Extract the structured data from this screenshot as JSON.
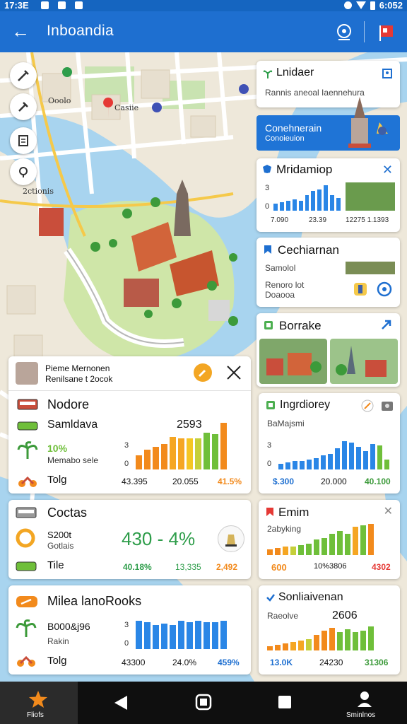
{
  "status_bar": {
    "time": "17:3E",
    "right_time": "6:052"
  },
  "app_bar": {
    "title": "Inboandia"
  },
  "map": {
    "labels": [
      "Ooolo",
      "Casiie",
      "2ctionis"
    ]
  },
  "cards": {
    "top_right": {
      "title": "Lnidaer",
      "subtitle": "Rannis aneoal Iaennehura"
    },
    "banner": {
      "line1": "Conehnerain",
      "line2": "Conoieuion"
    },
    "middle_right": {
      "title": "Mridamiop",
      "tick_3": "3",
      "tick_0": "0",
      "v1": "7.090",
      "v2": "23.39",
      "v3": "12275 1.1393"
    },
    "cechiarnan": {
      "title": "Cechiarnan",
      "line1": "Samolol",
      "line2": "Renoro lot",
      "line3": "Doaooa"
    },
    "bornake": {
      "title": "Borrake"
    },
    "stats_left": {
      "header_line1": "Pieme Mernonen",
      "header_line2": "Renilsane t 2ocok",
      "title": "Nodore",
      "subtitle": "Samldava",
      "headline": "2593",
      "pct": "10%",
      "sub_label": "Memabo sele",
      "tick_3": "3",
      "tick_0": "0",
      "foot_label": "Tolg",
      "foot_v1": "43.395",
      "foot_v2": "20.055",
      "foot_v3": "41.5%"
    },
    "stats_right": {
      "title": "Ingrdiorey",
      "subtitle": "BaMajsmi",
      "tick_3": "3",
      "tick_0": "0",
      "foot_v1": "$.300",
      "foot_v2": "20.000",
      "foot_v3": "40.100"
    },
    "coctas": {
      "title": "Coctas",
      "line1": "S200t",
      "line2": "Gotlais",
      "big": "430 - 4%",
      "foot_label": "Tile",
      "foot_v1": "40.18%",
      "foot_v2": "13,335",
      "foot_v3": "2,492"
    },
    "emim": {
      "title": "Emim",
      "subtitle": "2abyking",
      "foot_v1": "600",
      "foot_v2": "10%3806",
      "foot_v3": "4302"
    },
    "milea": {
      "title": "Milea lanoRooks",
      "line1": "B000&j96",
      "line2": "Rakin",
      "foot_label": "Tolg",
      "tick_3": "3",
      "tick_0": "0",
      "foot_v1": "43300",
      "foot_v2": "24.0%",
      "foot_v3": "459%"
    },
    "sonlia": {
      "title": "Sonliaivenan",
      "line1": "Raeolve",
      "headline": "2606",
      "foot_v1": "13.0K",
      "foot_v2": "24230",
      "foot_v3": "31306"
    }
  },
  "bottom_nav": {
    "home_label": "Fliofs",
    "profile_label": "Sminlnos"
  },
  "colors": {
    "primary": "#1e6fd0",
    "orange": "#f28a1c",
    "green": "#6fbf3a",
    "blue": "#2a86e6"
  },
  "icons": [
    "back-arrow-icon",
    "help-icon",
    "flag-icon",
    "tools-icon",
    "hammer-icon",
    "document-icon",
    "location-icon",
    "star-icon",
    "back-triangle-icon",
    "home-circle-icon",
    "square-icon",
    "person-icon"
  ]
}
